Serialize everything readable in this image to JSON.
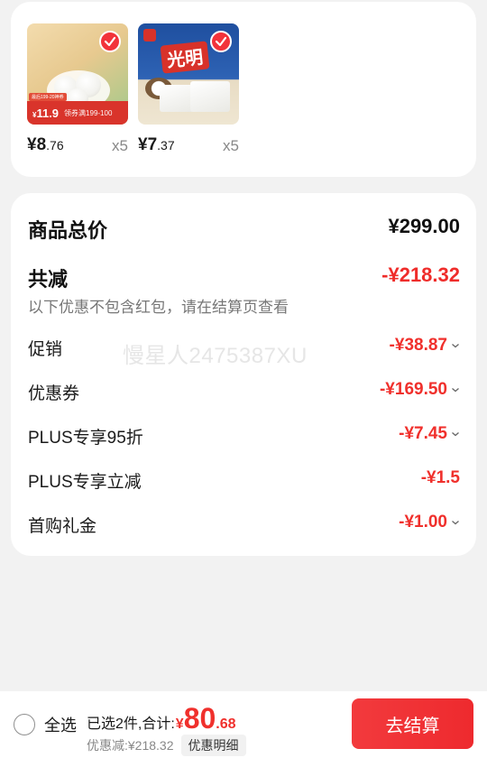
{
  "products": [
    {
      "price_int": "¥8",
      "price_dec": ".76",
      "qty": "x5",
      "badge_small": "最后199-20神券",
      "badge_price_symbol": "¥",
      "badge_price": "11.9",
      "badge_note": "领券满199-100"
    },
    {
      "price_int": "¥7",
      "price_dec": ".37",
      "qty": "x5",
      "brand": "光明"
    }
  ],
  "summary": {
    "total_label": "商品总价",
    "total_value": "¥299.00",
    "reduce_label": "共减",
    "reduce_value": "-¥218.32",
    "note": "以下优惠不包含红包，请在结算页查看",
    "items": [
      {
        "label": "促销",
        "value": "-¥38.87",
        "expandable": true
      },
      {
        "label": "优惠券",
        "value": "-¥169.50",
        "expandable": true
      },
      {
        "label": "PLUS专享95折",
        "value": "-¥7.45",
        "expandable": true
      },
      {
        "label": "PLUS专享立减",
        "value": "-¥1.5",
        "expandable": false
      },
      {
        "label": "首购礼金",
        "value": "-¥1.00",
        "expandable": true
      }
    ]
  },
  "watermark": "慢星人2475387XU",
  "bottom": {
    "select_all": "全选",
    "selected_text": "已选2件,合计:",
    "pay_symbol": "¥",
    "pay_int": "80",
    "pay_dec": ".68",
    "discount_text": "优惠减:¥218.32",
    "detail_button": "优惠明细",
    "checkout_button": "去结算"
  },
  "colors": {
    "accent": "#f0302c",
    "background": "#f2f2f2"
  }
}
